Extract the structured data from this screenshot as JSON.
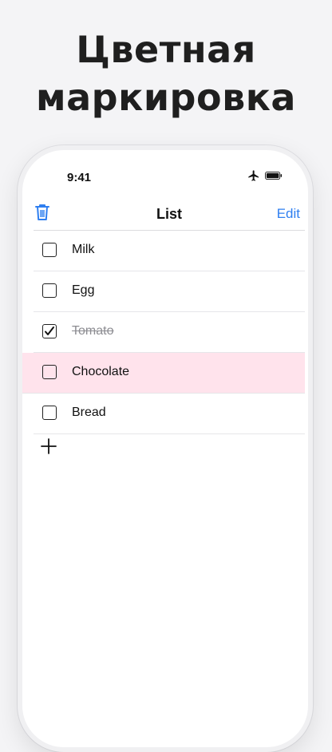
{
  "headline": {
    "line1": "Цветная",
    "line2": "маркировка"
  },
  "status_bar": {
    "time": "9:41",
    "icons": [
      "airplane-icon",
      "battery-icon"
    ]
  },
  "navbar": {
    "title": "List",
    "edit_label": "Edit",
    "left_icon": "trash-icon"
  },
  "items": [
    {
      "label": "Milk",
      "checked": false,
      "highlight": null
    },
    {
      "label": "Egg",
      "checked": false,
      "highlight": null
    },
    {
      "label": "Tomato",
      "checked": true,
      "highlight": null
    },
    {
      "label": "Chocolate",
      "checked": false,
      "highlight": "#ffe3ec"
    },
    {
      "label": "Bread",
      "checked": false,
      "highlight": null
    }
  ],
  "add_icon": "plus-icon",
  "colors": {
    "accent": "#2f7ff0",
    "highlight_pink": "#ffe3ec",
    "background": "#f4f4f6"
  }
}
